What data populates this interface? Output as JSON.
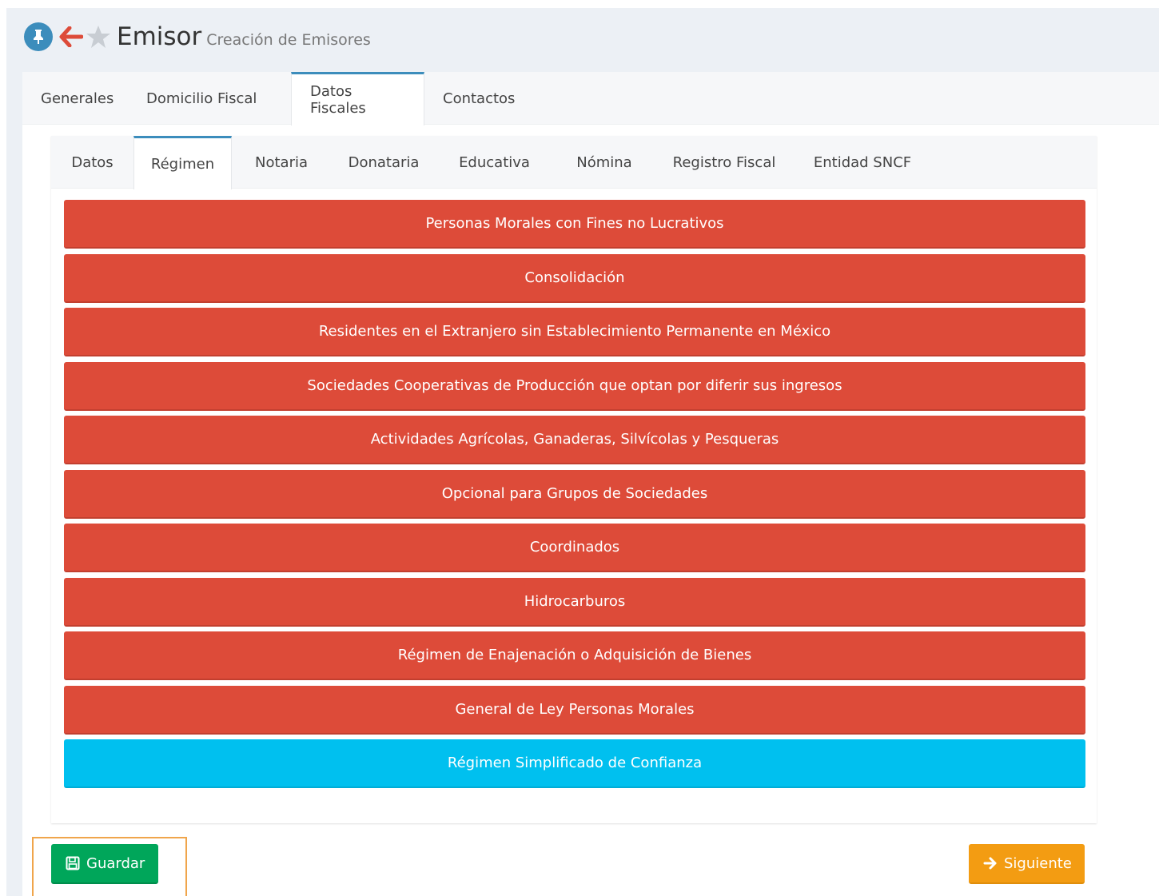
{
  "header": {
    "title": "Emisor",
    "subtitle": "Creación de Emisores",
    "icons": [
      "pin-icon",
      "back-arrow-icon",
      "star-icon"
    ]
  },
  "outer_tabs": {
    "items": [
      {
        "label": "Generales",
        "active": false
      },
      {
        "label": "Domicilio Fiscal",
        "active": false
      },
      {
        "label": "Datos Fiscales",
        "active": true
      },
      {
        "label": "Contactos",
        "active": false
      }
    ]
  },
  "inner_tabs": {
    "items": [
      {
        "label": "Datos",
        "active": false
      },
      {
        "label": "Régimen",
        "active": true
      },
      {
        "label": "Notaria",
        "active": false
      },
      {
        "label": "Donataria",
        "active": false
      },
      {
        "label": "Educativa",
        "active": false
      },
      {
        "label": "Nómina",
        "active": false
      },
      {
        "label": "Registro Fiscal",
        "active": false
      },
      {
        "label": "Entidad SNCF",
        "active": false
      }
    ]
  },
  "regimes": {
    "items": [
      {
        "label": "Personas Morales con Fines no Lucrativos",
        "selected": false
      },
      {
        "label": "Consolidación",
        "selected": false
      },
      {
        "label": "Residentes en el Extranjero sin Establecimiento Permanente en México",
        "selected": false
      },
      {
        "label": "Sociedades Cooperativas de Producción que optan por diferir sus ingresos",
        "selected": false
      },
      {
        "label": "Actividades Agrícolas, Ganaderas, Silvícolas y Pesqueras",
        "selected": false
      },
      {
        "label": "Opcional para Grupos de Sociedades",
        "selected": false
      },
      {
        "label": "Coordinados",
        "selected": false
      },
      {
        "label": "Hidrocarburos",
        "selected": false
      },
      {
        "label": "Régimen de Enajenación o Adquisición de Bienes",
        "selected": false
      },
      {
        "label": "General de Ley Personas Morales",
        "selected": false
      },
      {
        "label": "Régimen Simplificado de Confianza",
        "selected": true
      }
    ]
  },
  "actions": {
    "save_label": "Guardar",
    "next_label": "Siguiente"
  },
  "colors": {
    "unselected": "#dd4b39",
    "selected": "#00c0ef",
    "save": "#00a65a",
    "next": "#f39c12",
    "tab_accent": "#3c8dbc",
    "highlight_outline": "#f0a54b"
  }
}
